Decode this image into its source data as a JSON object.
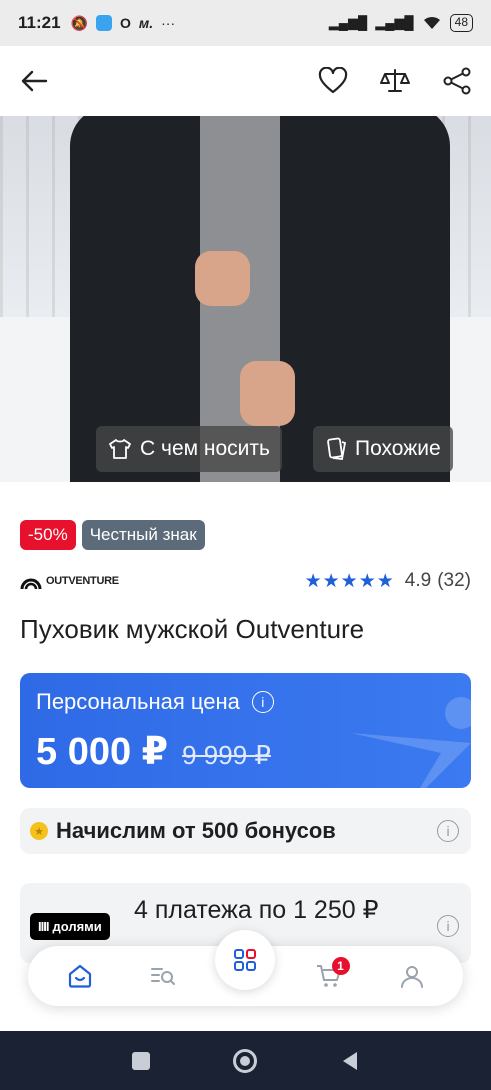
{
  "status_bar": {
    "time": "11:21",
    "battery": "48"
  },
  "hero": {
    "chips": [
      {
        "label": "С чем носить",
        "icon": "shirt-icon"
      },
      {
        "label": "Похожие",
        "icon": "cards-icon"
      }
    ]
  },
  "badges": {
    "discount": "-50%",
    "honest_mark": "Честный знак"
  },
  "brand": {
    "name": "OUTVENTURE"
  },
  "rating": {
    "value": "4.9",
    "count": "(32)",
    "stars": "★★★★★"
  },
  "product": {
    "title": "Пуховик мужской Outventure"
  },
  "price": {
    "label": "Персональная цена",
    "current": "5 000 ₽",
    "old": "9 999 ₽",
    "accent": "#2f6ae6"
  },
  "bonus": {
    "text": "Начислим от 500 бонусов"
  },
  "installment": {
    "provider": "долями",
    "text": "4 платежа по 1 250 ₽"
  },
  "bottom_nav": {
    "items": [
      "home-icon",
      "catalog-search-icon",
      "grid-icon",
      "cart-icon",
      "profile-icon"
    ],
    "cart_count": "1"
  },
  "colors": {
    "discount_red": "#e8112d",
    "brand_blue": "#1f5fd8"
  }
}
